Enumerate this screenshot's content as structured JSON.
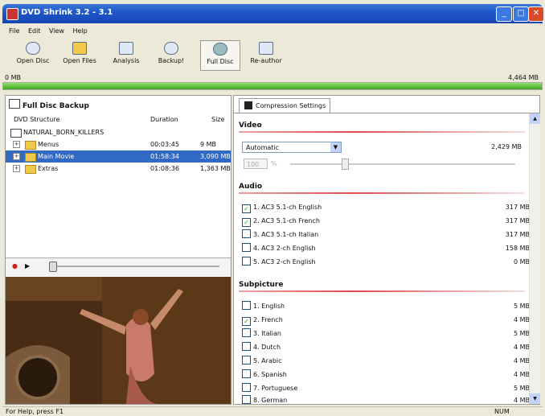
{
  "window": {
    "title": "DVD Shrink 3.2 - 3.1"
  },
  "menu": [
    "File",
    "Edit",
    "View",
    "Help"
  ],
  "toolbar": [
    {
      "label": "Open Disc",
      "icon": "disc-icon"
    },
    {
      "label": "Open Files",
      "icon": "folder-icon"
    },
    {
      "label": "Analysis",
      "icon": "analysis-icon"
    },
    {
      "label": "Backup!",
      "icon": "backup-icon"
    },
    {
      "label": "Full Disc",
      "icon": "full-disc-icon"
    },
    {
      "label": "Re-author",
      "icon": "re-author-icon"
    }
  ],
  "progress": {
    "left_label": "0 MB",
    "right_label": "4,464 MB",
    "fill_fraction": 1.0,
    "color": "#3ca51c"
  },
  "left_panel": {
    "title": "Full Disc Backup",
    "columns": [
      "DVD Structure",
      "Duration",
      "Size"
    ],
    "root": "NATURAL_BORN_KILLERS",
    "rows": [
      {
        "expander": "+",
        "name": "Menus",
        "duration": "00:03:45",
        "size": "9 MB",
        "selected": false
      },
      {
        "expander": "+",
        "name": "Main Movie",
        "duration": "01:58:34",
        "size": "3,090 MB",
        "selected": true
      },
      {
        "expander": "+",
        "name": "Extras",
        "duration": "01:08:36",
        "size": "1,363 MB",
        "selected": false
      }
    ]
  },
  "player": {
    "record": "●",
    "play": "▶"
  },
  "right_panel": {
    "tab": "Compression Settings",
    "video_header": "Video",
    "video_mode": "Automatic",
    "video_size": "2,429 MB",
    "percent_value": "100",
    "percent_sign": "%",
    "audio_header": "Audio",
    "audio": [
      {
        "label": "1. AC3 5.1-ch English",
        "size": "317 MB",
        "checked": true
      },
      {
        "label": "2. AC3 5.1-ch French",
        "size": "317 MB",
        "checked": true
      },
      {
        "label": "3. AC3 5.1-ch Italian",
        "size": "317 MB",
        "checked": false
      },
      {
        "label": "4. AC3 2-ch English",
        "size": "158 MB",
        "checked": false
      },
      {
        "label": "5. AC3 2-ch English",
        "size": "0 MB",
        "checked": false
      }
    ],
    "subpicture_header": "Subpicture",
    "subpicture": [
      {
        "label": "1. English",
        "size": "5 MB",
        "checked": false
      },
      {
        "label": "2. French",
        "size": "4 MB",
        "checked": true
      },
      {
        "label": "3. Italian",
        "size": "5 MB",
        "checked": false
      },
      {
        "label": "4. Dutch",
        "size": "4 MB",
        "checked": false
      },
      {
        "label": "5. Arabic",
        "size": "4 MB",
        "checked": false
      },
      {
        "label": "6. Spanish",
        "size": "4 MB",
        "checked": false
      },
      {
        "label": "7. Portuguese",
        "size": "5 MB",
        "checked": false
      },
      {
        "label": "8. German",
        "size": "4 MB",
        "checked": false
      }
    ]
  },
  "status": {
    "left": "For Help, press F1",
    "right": "NUM"
  }
}
